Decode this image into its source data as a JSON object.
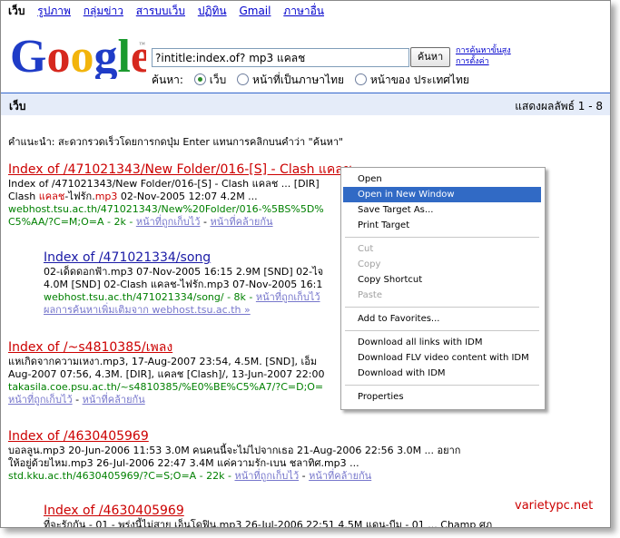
{
  "nav": {
    "items": [
      "เว็บ",
      "รูปภาพ",
      "กลุ่มข่าว",
      "สารบบเว็บ",
      "ปฏิทิน",
      "Gmail",
      "ภาษาอื่น"
    ]
  },
  "logo": {
    "text": "Google",
    "tm": "™"
  },
  "search": {
    "query": "?intitle:index.of? mp3 แคลช",
    "button": "ค้นหา",
    "advanced": "การค้นหาขั้นสูง",
    "preferences": "การตั้งค่า",
    "scope_label": "ค้นหา:",
    "options": [
      "เว็บ",
      "หน้าที่เป็นภาษาไทย",
      "หน้าของ ประเทศไทย"
    ],
    "selected": "เว็บ"
  },
  "bar": {
    "left": "เว็บ",
    "right": "แสดงผลลัพธ์ 1 - 8"
  },
  "tip": "คำแนะนำ: สะดวกรวดเร็วโดยการกดปุ่ม Enter แทนการคลิกบนคำว่า \"ค้นหา\"",
  "results": [
    {
      "title": "Index of /471021343/New Folder/016-[S] - Clash แคลช",
      "line1": "Index of /471021343/New Folder/016-[S] - Clash แคลช ... [DIR]",
      "line2a": "Clash ",
      "line2b": "แคลช",
      "line2c": "-ไฟรัก.",
      "line2d": "mp3",
      "line2e": " 02-Nov-2005 12:07 4.2M ...",
      "url": "webhost.tsu.ac.th/471021343/New%20Folder/016-%5BS%5D%",
      "url2": "C5%AA/?C=M;O=A - 2k - ",
      "cached": "หน้าที่ถูกเก็บไว้",
      "similar": "หน้าที่คล้ายกัน"
    },
    {
      "title": "Index of /471021334/song",
      "line1": "02-เด็ดดอกฟ้า.mp3 07-Nov-2005 16:15 2.9M [SND] 02-ไจ",
      "line2": "4.0M [SND] 02-Clash แคลช-ไฟรัก.mp3 07-Nov-2005 16:1",
      "url": "webhost.tsu.ac.th/471021334/song/ - 8k - ",
      "cached": "หน้าที่ถูกเก็บไว้",
      "more": "ผลการค้นหาเพิ่มเติมจาก webhost.tsu.ac.th »"
    },
    {
      "title": "Index of /~s4810385/เพลง",
      "line1": "แหเกิดจากความเหงา.mp3, 17-Aug-2007 23:54, 4.5M. [SND], เอ็ม",
      "line2": "Aug-2007 07:56, 4.3M. [DIR], แคลช [Clash]/, 13-Jun-2007 22:00",
      "url": "takasila.coe.psu.ac.th/~s4810385/%E0%BE%C5%A7/?C=D;O=",
      "cached": "หน้าที่ถูกเก็บไว้",
      "similar": "หน้าที่คล้ายกัน"
    },
    {
      "title": "Index of /4630405969",
      "line1": "บอลลูน.mp3 20-Jun-2006 11:53 3.0M คนคนนี้จะไม่ไปจากเธอ 21-Aug-2006 22:56 3.0M ... อยาก",
      "line2": "ให้อยู่ด้วยไหม.mp3 26-Jul-2006 22:47 3.4M แค่ความรัก-เบน ชลาทิศ.mp3 ...",
      "url": "std.kku.ac.th/4630405969/?C=S;O=A - 22k - ",
      "cached": "หน้าที่ถูกเก็บไว้",
      "similar": "หน้าที่คล้ายกัน"
    },
    {
      "title": "Index of /4630405969",
      "line1": "ที่จะรักกัน - 01 - พรุ่งนี้ไม่สาย เอ็นโดฟิน.mp3 26-Jul-2006 22:51 4.5M แดน-บีม - 01 ... Champ ศุภ"
    }
  ],
  "context_menu": {
    "items": [
      {
        "label": "Open"
      },
      {
        "label": "Open in New Window",
        "selected": true
      },
      {
        "label": "Save Target As..."
      },
      {
        "label": "Print Target"
      },
      {
        "label": "Cut",
        "disabled": true
      },
      {
        "label": "Copy",
        "disabled": true
      },
      {
        "label": "Copy Shortcut"
      },
      {
        "label": "Paste",
        "disabled": true
      },
      {
        "label": "Add to Favorites..."
      },
      {
        "label": "Download all links with IDM"
      },
      {
        "label": "Download FLV video content with IDM"
      },
      {
        "label": "Download with IDM"
      },
      {
        "label": "Properties"
      }
    ]
  },
  "watermark": "varietypc.net",
  "colors": {
    "link": "#0000cc",
    "title": "#cc0000",
    "url": "#008000",
    "bar": "#e5ecf9",
    "menu_highlight": "#316ac5"
  }
}
